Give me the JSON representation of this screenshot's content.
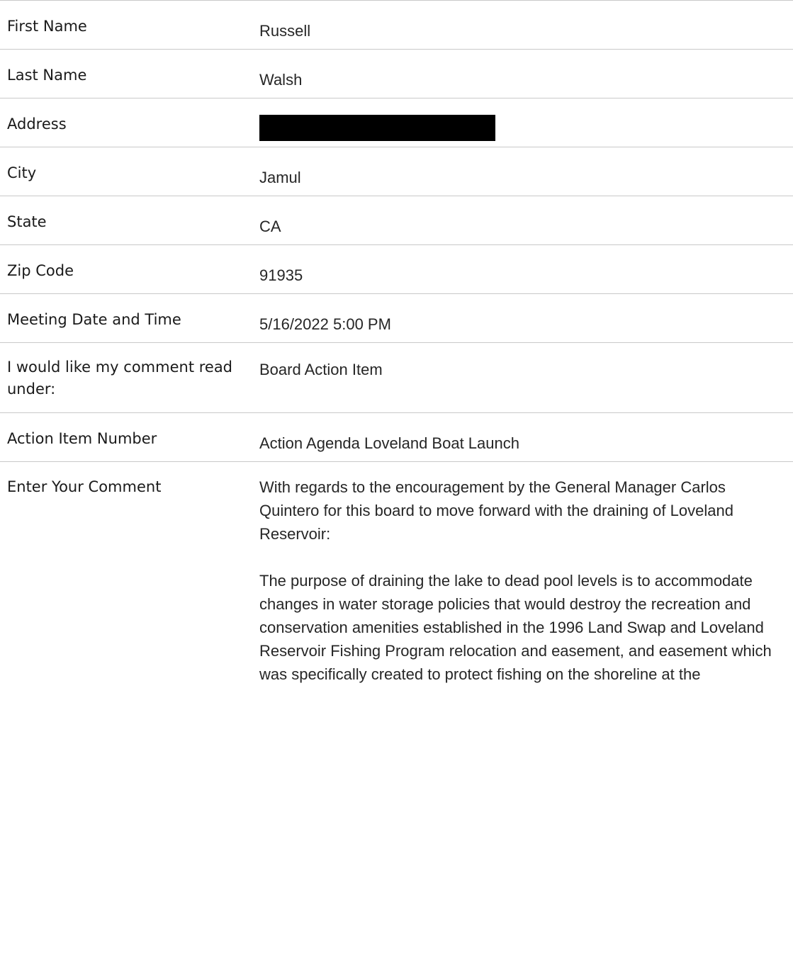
{
  "fields": [
    {
      "label": "First Name",
      "value": "Russell"
    },
    {
      "label": "Last Name",
      "value": "Walsh"
    },
    {
      "label": "Address",
      "value": "",
      "redacted": true
    },
    {
      "label": "City",
      "value": "Jamul"
    },
    {
      "label": "State",
      "value": "CA"
    },
    {
      "label": "Zip Code",
      "value": "91935"
    },
    {
      "label": "Meeting Date and Time",
      "value": "5/16/2022 5:00 PM"
    },
    {
      "label": "I would like my comment read under:",
      "value": "Board Action Item"
    },
    {
      "label": "Action Item Number",
      "value": "Action Agenda Loveland Boat Launch"
    }
  ],
  "comment": {
    "label": "Enter Your Comment",
    "paragraphs": [
      "With regards to the encouragement by the General Manager Carlos Quintero for this board to move forward with the draining of Loveland Reservoir:",
      "The purpose of draining the lake to dead pool levels is to accommodate changes in water storage policies that would destroy the recreation and conservation amenities established in the 1996 Land Swap and Loveland Reservoir Fishing Program relocation and easement, and easement which was specifically created to protect fishing on the shoreline at the"
    ]
  },
  "colors": {
    "divider": "#c9c9c9",
    "redaction": "#000000",
    "text": "#1a1a1a"
  }
}
